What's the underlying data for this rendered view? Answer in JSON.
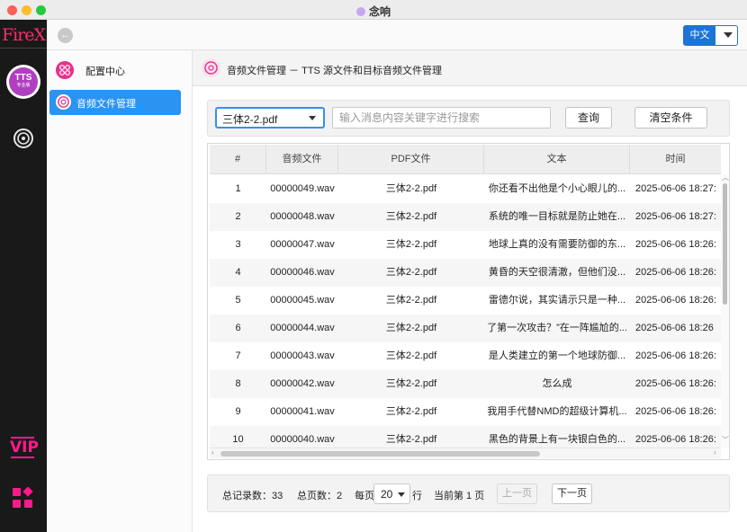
{
  "window": {
    "title": "念响"
  },
  "rail": {
    "logo": "FireX",
    "tts_label": "TTS",
    "tts_sub": "专业版",
    "vip_label": "VIP"
  },
  "topbar": {
    "language": "中文"
  },
  "sidebar": {
    "items": [
      {
        "label": "配置中心"
      },
      {
        "label": "音频文件管理"
      }
    ]
  },
  "breadcrumb": {
    "title": "音频文件管理 － TTS 源文件和目标音频文件管理"
  },
  "search": {
    "pdf_select": "三体2-2.pdf",
    "keyword_placeholder": "输入消息内容关键字进行搜索",
    "query_label": "查询",
    "clear_label": "清空条件"
  },
  "table": {
    "columns": [
      "#",
      "音频文件",
      "PDF文件",
      "文本",
      "时间"
    ],
    "rows": [
      [
        "1",
        "00000049.wav",
        "三体2-2.pdf",
        "你还看不出他是个小心眼儿的...",
        "2025-06-06 18:27:"
      ],
      [
        "2",
        "00000048.wav",
        "三体2-2.pdf",
        "系统的唯一目标就是防止她在...",
        "2025-06-06 18:27:"
      ],
      [
        "3",
        "00000047.wav",
        "三体2-2.pdf",
        "地球上真的没有需要防御的东...",
        "2025-06-06 18:26:"
      ],
      [
        "4",
        "00000046.wav",
        "三体2-2.pdf",
        "黄昏的天空很清澈，但他们没...",
        "2025-06-06 18:26:"
      ],
      [
        "5",
        "00000045.wav",
        "三体2-2.pdf",
        "雷德尔说，其实请示只是一种...",
        "2025-06-06 18:26:"
      ],
      [
        "6",
        "00000044.wav",
        "三体2-2.pdf",
        "了第一次攻击？”在一阵尴尬的...",
        "2025-06-06 18:26"
      ],
      [
        "7",
        "00000043.wav",
        "三体2-2.pdf",
        "是人类建立的第一个地球防御...",
        "2025-06-06 18:26:"
      ],
      [
        "8",
        "00000042.wav",
        "三体2-2.pdf",
        "怎么成",
        "2025-06-06 18:26:"
      ],
      [
        "9",
        "00000041.wav",
        "三体2-2.pdf",
        "我用手代替NMD的超级计算机...",
        "2025-06-06 18:26:"
      ],
      [
        "10",
        "00000040.wav",
        "三体2-2.pdf",
        "黑色的背景上有一块银白色的...",
        "2025-06-06 18:26:"
      ]
    ]
  },
  "pager": {
    "total_records": "总记录数：33",
    "total_pages": "总页数：2",
    "per_page_prefix": "每页",
    "per_page_value": "20",
    "per_page_suffix": "行",
    "current_page": "当前第 1 页",
    "prev_label": "上一页",
    "next_label": "下一页"
  },
  "colors": {
    "accent": "#2b93f2",
    "brand": "#ff2d6e",
    "rail_bg": "#191919"
  }
}
